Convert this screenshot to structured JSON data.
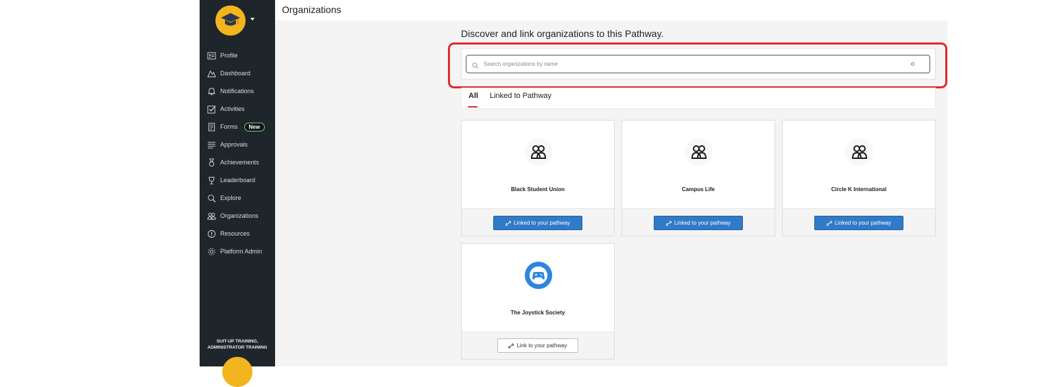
{
  "app": {
    "page_title": "Organizations"
  },
  "sidebar": {
    "new_badge": "New",
    "items": [
      {
        "label": "Profile",
        "icon": "profile-card-icon"
      },
      {
        "label": "Dashboard",
        "icon": "dashboard-icon"
      },
      {
        "label": "Notifications",
        "icon": "bell-icon"
      },
      {
        "label": "Activities",
        "icon": "checkbox-icon"
      },
      {
        "label": "Forms",
        "icon": "form-icon"
      },
      {
        "label": "Approvals",
        "icon": "approvals-list-icon"
      },
      {
        "label": "Achievements",
        "icon": "medal-icon"
      },
      {
        "label": "Leaderboard",
        "icon": "trophy-icon"
      },
      {
        "label": "Explore",
        "icon": "explore-search-icon"
      },
      {
        "label": "Organizations",
        "icon": "people-icon"
      },
      {
        "label": "Resources",
        "icon": "info-icon"
      },
      {
        "label": "Platform Admin",
        "icon": "gear-icon"
      }
    ],
    "org_line1": "SUIT-UP TRAINING,",
    "org_line2": "ADMINISTRATOR TRAINING"
  },
  "main": {
    "heading": "Discover and link organizations to this Pathway.",
    "search": {
      "placeholder": "Search organizations by name",
      "value": ""
    },
    "tabs": [
      {
        "label": "All",
        "active": true
      },
      {
        "label": "Linked to Pathway",
        "active": false
      }
    ],
    "cards": [
      {
        "name": "Black Student Union",
        "icon": "people-icon",
        "button": "Linked to your pathway",
        "linked": true
      },
      {
        "name": "Campus Life",
        "icon": "people-icon",
        "button": "Linked to your pathway",
        "linked": true
      },
      {
        "name": "Circle K International",
        "icon": "people-icon",
        "button": "Linked to your pathway",
        "linked": true
      },
      {
        "name": "The Joystick Society",
        "icon": "gamepad-icon",
        "button": "Link to your pathway",
        "linked": false
      }
    ]
  },
  "colors": {
    "accent_red": "#e02a2a",
    "button_blue": "#2f7bc8",
    "sidebar_bg": "#1e252b",
    "logo_gold": "#f2b51d"
  }
}
